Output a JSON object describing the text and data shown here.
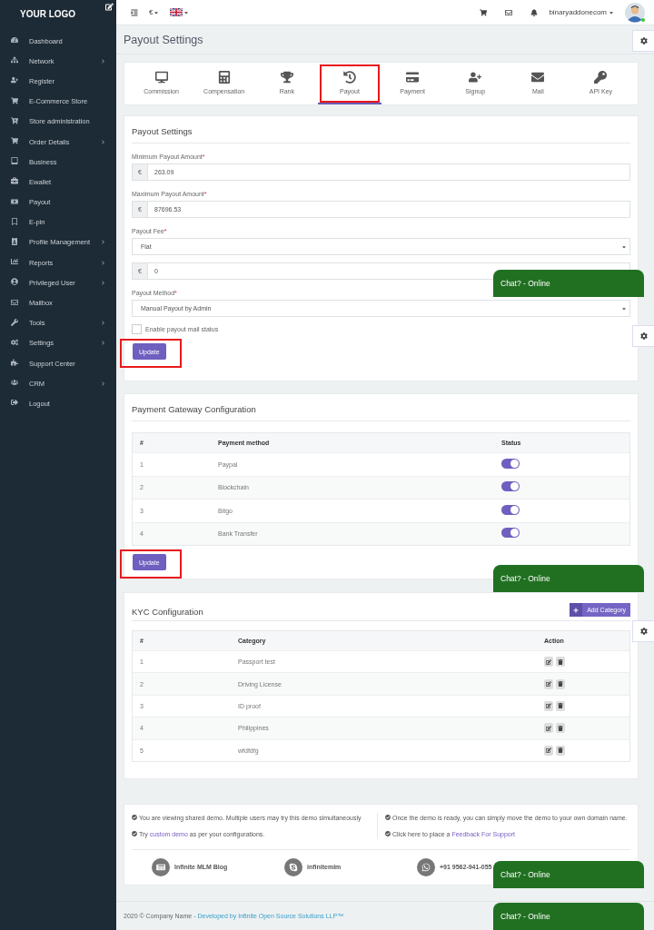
{
  "sidebar": {
    "logo": "YOUR LOGO",
    "items": [
      {
        "label": "Dashboard",
        "has_submenu": false
      },
      {
        "label": "Network",
        "has_submenu": true
      },
      {
        "label": "Register",
        "has_submenu": false
      },
      {
        "label": "E-Commerce Store",
        "has_submenu": false
      },
      {
        "label": "Store administration",
        "has_submenu": false
      },
      {
        "label": "Order Details",
        "has_submenu": true
      },
      {
        "label": "Business",
        "has_submenu": false
      },
      {
        "label": "Ewallet",
        "has_submenu": false
      },
      {
        "label": "Payout",
        "has_submenu": false
      },
      {
        "label": "E-pin",
        "has_submenu": false
      },
      {
        "label": "Profile Management",
        "has_submenu": true
      },
      {
        "label": "Reports",
        "has_submenu": true
      },
      {
        "label": "Privileged User",
        "has_submenu": true
      },
      {
        "label": "Mailbox",
        "has_submenu": false
      },
      {
        "label": "Tools",
        "has_submenu": true
      },
      {
        "label": "Settings",
        "has_submenu": true
      },
      {
        "label": "Support Center",
        "has_submenu": false
      },
      {
        "label": "CRM",
        "has_submenu": true
      },
      {
        "label": "Logout",
        "has_submenu": false
      }
    ]
  },
  "topbar": {
    "currency": "€",
    "username": "binaryaddonecom"
  },
  "page_title": "Payout Settings",
  "tabs": [
    {
      "label": "Commission",
      "selected": false,
      "highlighted": false
    },
    {
      "label": "Compensation",
      "selected": false,
      "highlighted": false
    },
    {
      "label": "Rank",
      "selected": false,
      "highlighted": false
    },
    {
      "label": "Payout",
      "selected": true,
      "highlighted": true
    },
    {
      "label": "Payment",
      "selected": false,
      "highlighted": false
    },
    {
      "label": "Signup",
      "selected": false,
      "highlighted": false
    },
    {
      "label": "Mail",
      "selected": false,
      "highlighted": false
    },
    {
      "label": "API Key",
      "selected": false,
      "highlighted": false
    }
  ],
  "payout_settings": {
    "title": "Payout Settings",
    "fields": [
      {
        "kind": "amount",
        "label": "Minimum Payout Amount",
        "required_mark": "*",
        "prefix": "€",
        "value": "263.09"
      },
      {
        "kind": "amount",
        "label": "Maximum Payout Amount",
        "required_mark": "*",
        "prefix": "€",
        "value": "87696.53"
      },
      {
        "kind": "select",
        "label": "Payout Fee",
        "required_mark": "*",
        "value": "Flat"
      },
      {
        "kind": "amount",
        "prefix": "€",
        "value": "0"
      },
      {
        "kind": "select",
        "label": "Payout Method",
        "required_mark": "*",
        "value": "Manual Payout by Admin"
      }
    ],
    "checkbox": {
      "label": "Enable payout mail status",
      "checked": false
    },
    "button": {
      "label": "Update",
      "highlighted": true
    }
  },
  "payment_gateway": {
    "title": "Payment Gateway Configuration",
    "columns": [
      "#",
      "Payment method",
      "Status"
    ],
    "rows": [
      {
        "number": "1",
        "method": "Paypal",
        "on": true
      },
      {
        "number": "2",
        "method": "Blockchain",
        "on": true
      },
      {
        "number": "3",
        "method": "Bitgo",
        "on": true
      },
      {
        "number": "4",
        "method": "Bank Transfer",
        "on": true
      }
    ],
    "button": {
      "label": "Update",
      "highlighted": true
    }
  },
  "kyc": {
    "title": "KYC Configuration",
    "add_button": "Add Category",
    "columns": [
      "#",
      "Category",
      "Action"
    ],
    "rows": [
      {
        "number": "1",
        "category": "Passport test"
      },
      {
        "number": "2",
        "category": "Driving License"
      },
      {
        "number": "3",
        "category": "ID proof"
      },
      {
        "number": "4",
        "category": "Philippines"
      },
      {
        "number": "5",
        "category": "wfdfdfg"
      }
    ]
  },
  "notes": {
    "left": [
      {
        "text": "You are viewing shared demo. Multiple users may try this demo simultaneously"
      },
      {
        "text": "Try",
        "link": "custom demo",
        "after": "as per your configurations."
      }
    ],
    "right": [
      {
        "text": "Once the demo is ready, you can simply move the demo to your own domain name."
      },
      {
        "text": "Click here to place a",
        "link": "Feedback For Support"
      }
    ]
  },
  "contacts": [
    {
      "label": "Infinite MLM Blog"
    },
    {
      "label": "infinitemlm"
    },
    {
      "label": "+91 9562-941-055"
    }
  ],
  "copyright": {
    "text": "2020 © Company Name -",
    "link": "Developed by Infinite Open Source Solutions LLP™"
  },
  "chat_widgets": [
    {
      "label": "Chat? - Online"
    },
    {
      "label": "Chat? - Online"
    },
    {
      "label": "Chat? - Online"
    },
    {
      "label": "Chat? - Online"
    }
  ]
}
